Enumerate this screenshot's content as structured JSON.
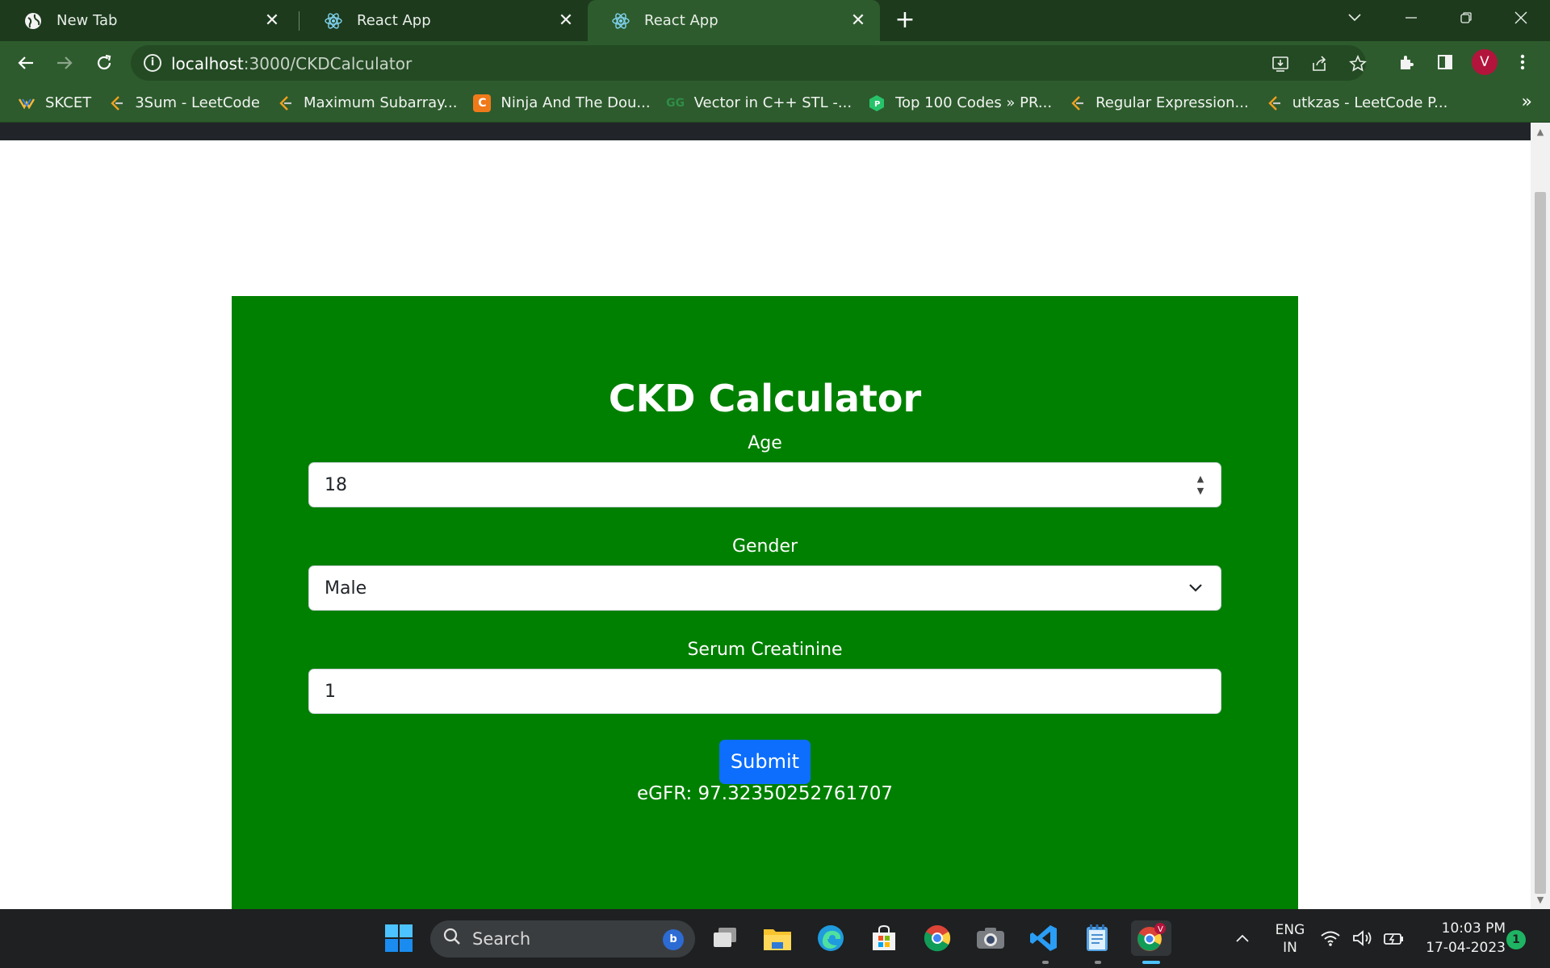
{
  "browser": {
    "tabs": [
      {
        "title": "New Tab",
        "icon": "globe-icon"
      },
      {
        "title": "React App",
        "icon": "react-icon"
      },
      {
        "title": "React App",
        "icon": "react-icon",
        "active": true
      }
    ],
    "address": {
      "host": "localhost",
      "path": ":3000/CKDCalculator"
    },
    "profile_initial": "V",
    "bookmarks": [
      {
        "label": "SKCET",
        "icon": "skcet-icon"
      },
      {
        "label": "3Sum - LeetCode",
        "icon": "leetcode-icon"
      },
      {
        "label": "Maximum Subarray...",
        "icon": "leetcode-icon"
      },
      {
        "label": "Ninja And The Dou...",
        "icon": "codingninjas-icon"
      },
      {
        "label": "Vector in C++ STL -...",
        "icon": "gfg-icon"
      },
      {
        "label": "Top 100 Codes » PR...",
        "icon": "prepinsta-icon"
      },
      {
        "label": "Regular Expression...",
        "icon": "leetcode-icon"
      },
      {
        "label": "utkzas - LeetCode P...",
        "icon": "leetcode-icon"
      }
    ]
  },
  "app": {
    "title": "CKD Calculator",
    "age": {
      "label": "Age",
      "value": "18"
    },
    "gender": {
      "label": "Gender",
      "value": "Male"
    },
    "creatinine": {
      "label": "Serum Creatinine",
      "value": "1"
    },
    "submit_label": "Submit",
    "result": "eGFR: 97.32350252761707"
  },
  "taskbar": {
    "search_placeholder": "Search",
    "lang_line1": "ENG",
    "lang_line2": "IN",
    "time": "10:03 PM",
    "date": "17-04-2023",
    "notifications": "1"
  },
  "colors": {
    "card_green": "#008000",
    "submit_blue": "#0d6efd",
    "browser_green": "#2d5b2d"
  }
}
